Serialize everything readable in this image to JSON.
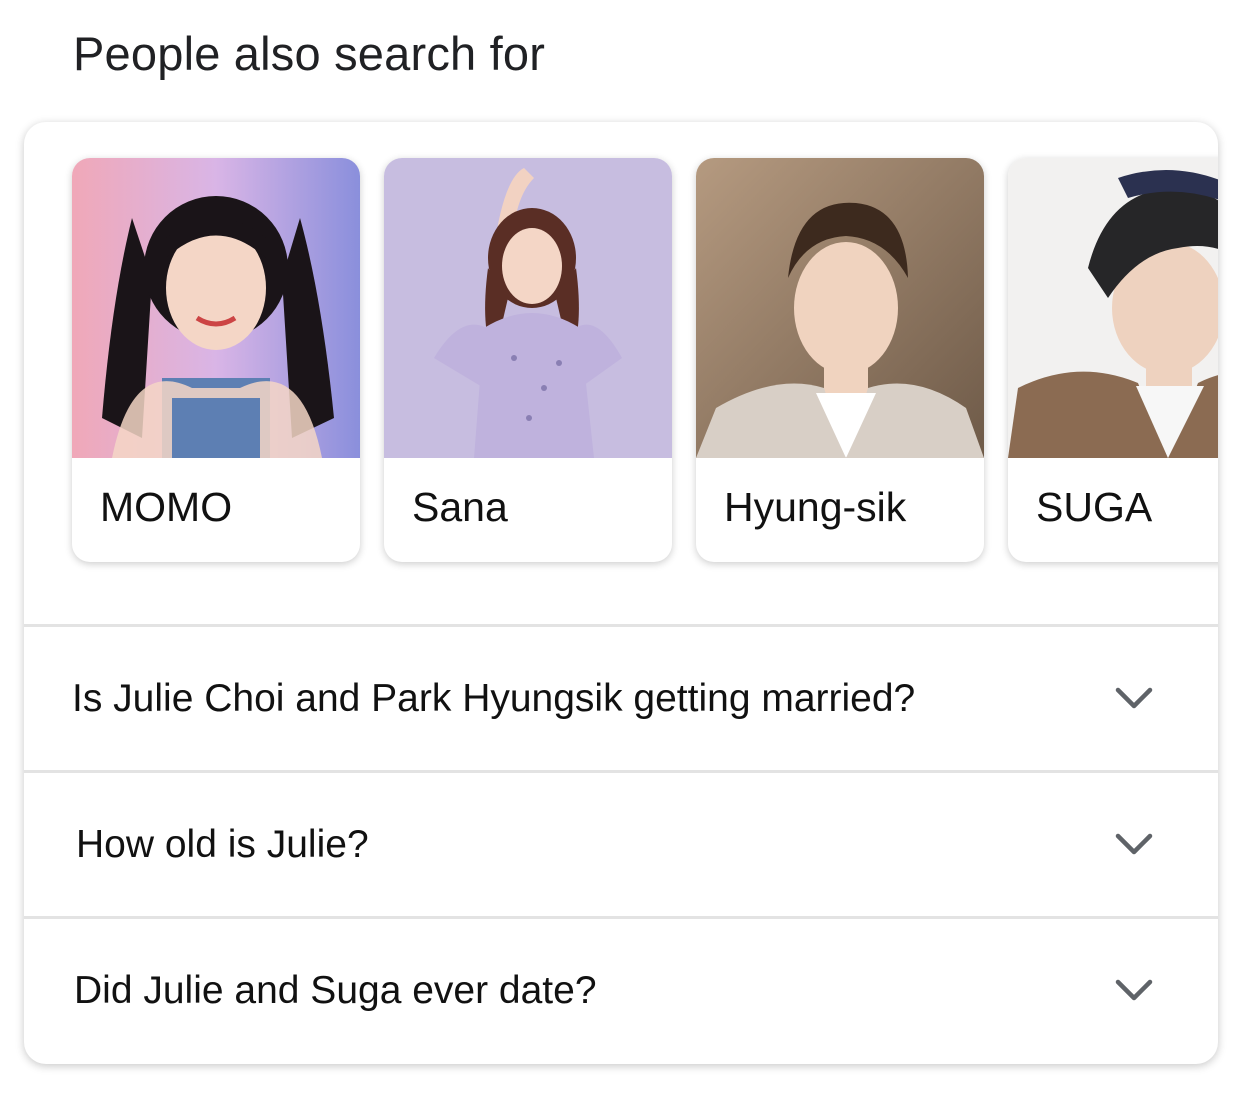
{
  "section_title": "People also search for",
  "people": [
    {
      "name": "MOMO",
      "bg": "#c9a3d8",
      "hair": "#1a1418",
      "top": "#5d7fb3"
    },
    {
      "name": "Sana",
      "bg": "#c7bde0",
      "hair": "#5a2e25",
      "top": "#bfb2dd"
    },
    {
      "name": "Hyung-sik",
      "bg": "#9a8168",
      "hair": "#3d2a1e",
      "top": "#d8cfc6"
    },
    {
      "name": "SUGA",
      "bg": "#f2f1f0",
      "hair": "#262628",
      "top": "#8b6b52"
    }
  ],
  "questions": [
    {
      "text": "Is Julie Choi and Park Hyungsik getting married?"
    },
    {
      "text": "How old is Julie?"
    },
    {
      "text": "Did Julie and Suga ever date?"
    }
  ],
  "icons": {
    "expand": "chevron-down-icon"
  }
}
